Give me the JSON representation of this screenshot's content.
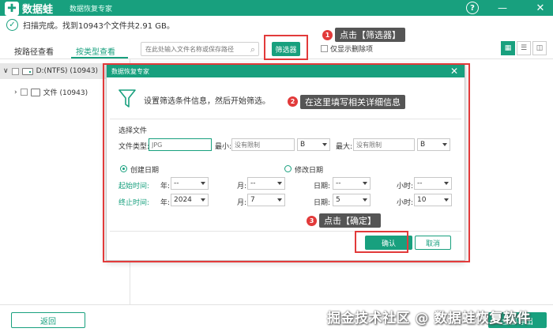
{
  "app": {
    "logo_mark": "✚",
    "name": "数据蛙",
    "subtitle": "数据恢复专家",
    "help_label": "?",
    "minimize_label": "—",
    "close_label": "✕"
  },
  "status": {
    "check": "✓",
    "text": "扫描完成。找到10943个文件共2.91 GB。"
  },
  "toolbar": {
    "tab_path": "按路径查看",
    "tab_type": "按类型查看",
    "search_placeholder": "在此处输入文件名称或保存路径",
    "filter_label": "筛选器",
    "only_deleted": "仅显示删除项",
    "view_icons": [
      "▦",
      "☰",
      "◫"
    ]
  },
  "tree": {
    "drive": "D:(NTFS) (10943)",
    "file": "文件 (10943)",
    "expand_down": "∨",
    "expand_right": "›"
  },
  "callouts": [
    {
      "num": "1",
      "text": "点击【筛选器】"
    },
    {
      "num": "2",
      "text": "在这里填写相关详细信息"
    },
    {
      "num": "3",
      "text": "点击【确定】"
    }
  ],
  "modal": {
    "title": "数据恢复专家",
    "close": "✕",
    "intro": "设置筛选条件信息，然后开始筛选。",
    "select_file": "选择文件",
    "file_type_label": "文件类型:",
    "file_type_placeholder": "JPG",
    "min_label": "最小:",
    "min_placeholder": "没有限制",
    "min_unit": "B",
    "max_label": "最大:",
    "max_placeholder": "没有限制",
    "max_unit": "B",
    "created_date": "创建日期",
    "modified_date": "修改日期",
    "start_label": "起始时间:",
    "end_label": "终止时间:",
    "year_label": "年:",
    "month_label": "月:",
    "day_label": "日期:",
    "hour_label": "小时:",
    "start": {
      "year": "--",
      "month": "--",
      "day": "--",
      "hour": "--"
    },
    "end": {
      "year": "2024",
      "month": "7",
      "day": "5",
      "hour": "10"
    },
    "ok": "确认",
    "cancel": "取消"
  },
  "bottom": {
    "back": "返回",
    "export": "全部导出",
    "watermark": "掘金技术社区 @ 数据蛙恢复软件"
  },
  "colors": {
    "accent": "#18a07e",
    "highlight": "#e23a3a"
  }
}
